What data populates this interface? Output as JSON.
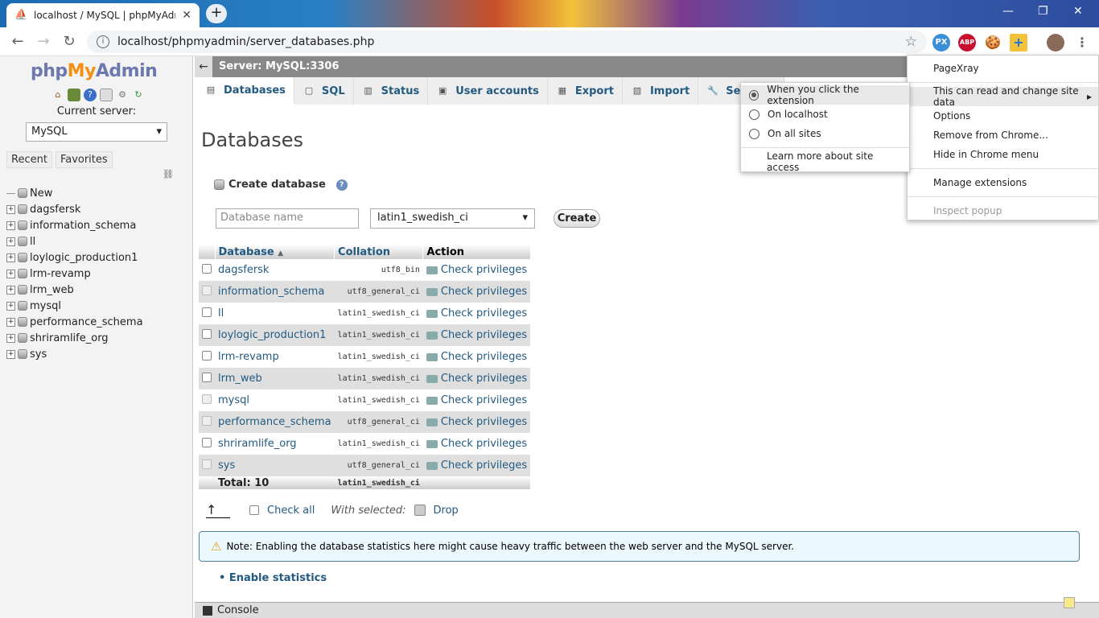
{
  "browser": {
    "tab_title": "localhost / MySQL | phpMyAdm",
    "url": "localhost/phpmyadmin/server_databases.php",
    "ext_px": "PX",
    "ext_abp": "ABP"
  },
  "sidebar": {
    "logo_php": "php",
    "logo_my": "My",
    "logo_admin": "Admin",
    "current_server_label": "Current server:",
    "server_value": "MySQL",
    "tab_recent": "Recent",
    "tab_favorites": "Favorites",
    "tree": [
      "New",
      "dagsfersk",
      "information_schema",
      "ll",
      "loylogic_production1",
      "lrm-revamp",
      "lrm_web",
      "mysql",
      "performance_schema",
      "shriramlife_org",
      "sys"
    ]
  },
  "server_bar": {
    "label": "Server: MySQL:3306"
  },
  "tabs": [
    {
      "label": "Databases"
    },
    {
      "label": "SQL"
    },
    {
      "label": "Status"
    },
    {
      "label": "User accounts"
    },
    {
      "label": "Export"
    },
    {
      "label": "Import"
    },
    {
      "label": "Settings"
    }
  ],
  "page_title": "Databases",
  "create": {
    "heading": "Create database",
    "name_placeholder": "Database name",
    "collation_value": "latin1_swedish_ci",
    "button": "Create"
  },
  "table": {
    "headers": {
      "database": "Database",
      "collation": "Collation",
      "action": "Action"
    },
    "rows": [
      {
        "name": "dagsfersk",
        "collation": "utf8_bin",
        "action": "Check privileges"
      },
      {
        "name": "information_schema",
        "collation": "utf8_general_ci",
        "action": "Check privileges"
      },
      {
        "name": "ll",
        "collation": "latin1_swedish_ci",
        "action": "Check privileges"
      },
      {
        "name": "loylogic_production1",
        "collation": "latin1_swedish_ci",
        "action": "Check privileges"
      },
      {
        "name": "lrm-revamp",
        "collation": "latin1_swedish_ci",
        "action": "Check privileges"
      },
      {
        "name": "lrm_web",
        "collation": "latin1_swedish_ci",
        "action": "Check privileges"
      },
      {
        "name": "mysql",
        "collation": "latin1_swedish_ci",
        "action": "Check privileges"
      },
      {
        "name": "performance_schema",
        "collation": "utf8_general_ci",
        "action": "Check privileges"
      },
      {
        "name": "shriramlife_org",
        "collation": "latin1_swedish_ci",
        "action": "Check privileges"
      },
      {
        "name": "sys",
        "collation": "utf8_general_ci",
        "action": "Check privileges"
      }
    ],
    "total_label": "Total: 10",
    "total_collation": "latin1_swedish_ci"
  },
  "bottom": {
    "check_all": "Check all",
    "with_selected": "With selected:",
    "drop": "Drop"
  },
  "note": "Note: Enabling the database statistics here might cause heavy traffic between the web server and the MySQL server.",
  "enable_stats": "Enable statistics",
  "console": "Console",
  "ext_menu": {
    "items": [
      "PageXray",
      "This can read and change site data",
      "Options",
      "Remove from Chrome...",
      "Hide in Chrome menu",
      "Manage extensions",
      "Inspect popup"
    ]
  },
  "site_access_menu": {
    "items": [
      "When you click the extension",
      "On localhost",
      "On all sites"
    ],
    "learn_more": "Learn more about site access"
  }
}
